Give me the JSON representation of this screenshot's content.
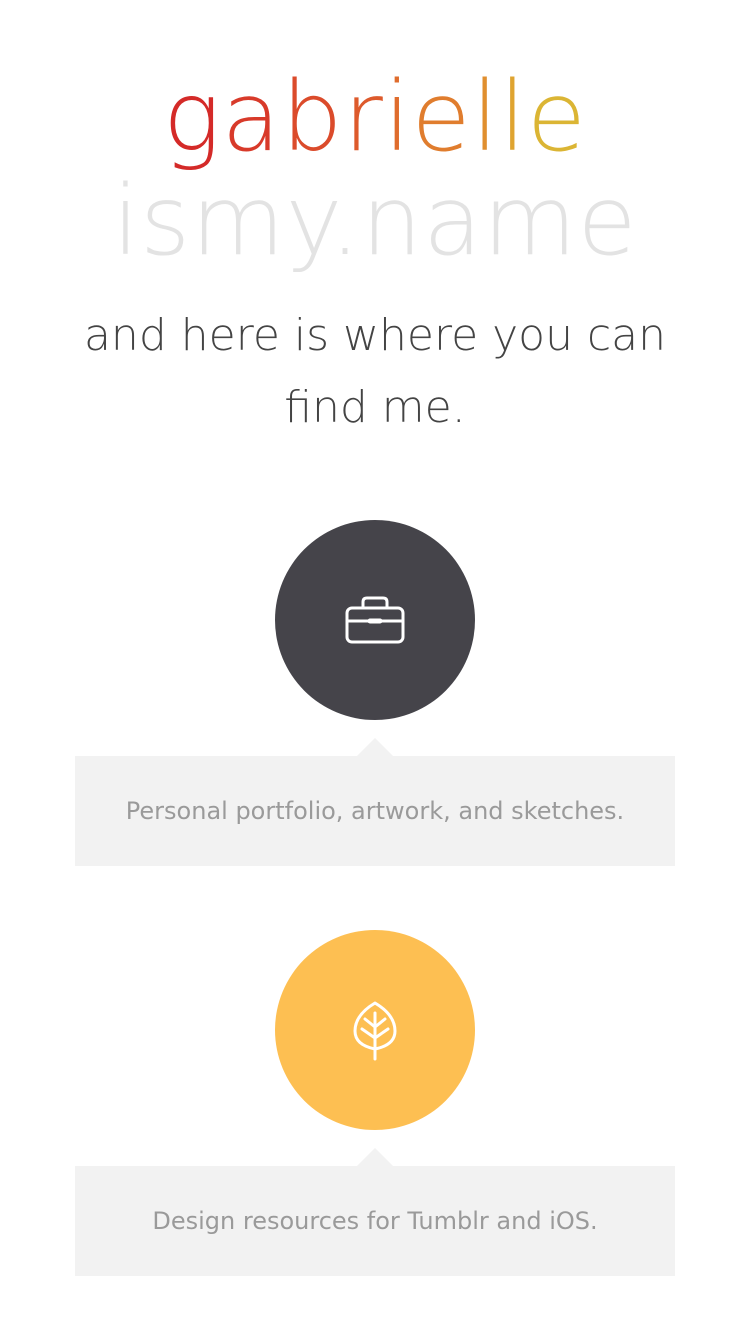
{
  "header": {
    "name_letters": [
      {
        "char": "g",
        "color": "#d42a28"
      },
      {
        "char": "a",
        "color": "#d83a2a"
      },
      {
        "char": "b",
        "color": "#db4b2b"
      },
      {
        "char": "r",
        "color": "#dd5a2c"
      },
      {
        "char": "i",
        "color": "#df6c2d"
      },
      {
        "char": "e",
        "color": "#e07d2e"
      },
      {
        "char": "l",
        "color": "#e08f2f"
      },
      {
        "char": "l",
        "color": "#dfa430"
      },
      {
        "char": "e",
        "color": "#dbb534"
      }
    ],
    "domain": "ismy.name",
    "tagline": "and here is where you can find me."
  },
  "links": [
    {
      "icon": "briefcase-icon",
      "circle_color": "#45444a",
      "description": "Personal portfolio, artwork, and sketches."
    },
    {
      "icon": "leaf-icon",
      "circle_color": "#fdbf52",
      "description": "Design resources for Tumblr and iOS."
    }
  ]
}
